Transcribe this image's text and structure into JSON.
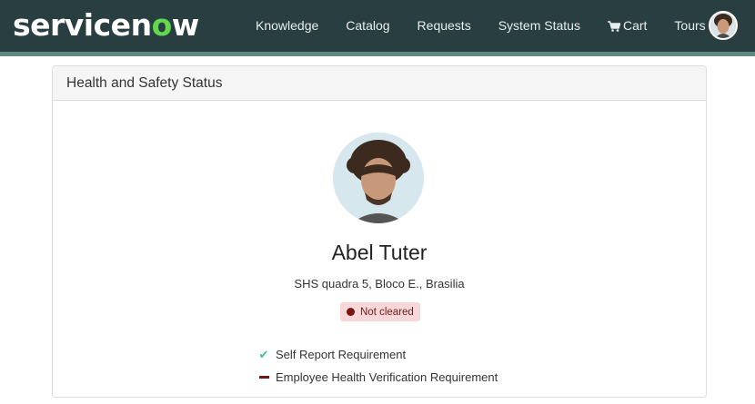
{
  "header": {
    "logo_text_a": "servicen",
    "logo_text_o": "o",
    "logo_text_b": "w",
    "nav": [
      "Knowledge",
      "Catalog",
      "Requests",
      "System Status",
      "Cart",
      "Tours"
    ]
  },
  "panel": {
    "title": "Health and Safety Status",
    "person": {
      "name": "Abel Tuter",
      "address": "SHS quadra 5, Bloco E., Brasilia",
      "status": "Not cleared"
    },
    "requirements": [
      {
        "label": "Self Report Requirement",
        "state": "complete",
        "icon": "check-icon"
      },
      {
        "label": "Employee Health Verification Requirement",
        "state": "incomplete",
        "icon": "dash-icon"
      }
    ]
  },
  "colors": {
    "header_bg": "#293e40",
    "accent": "#62d84e",
    "badge_bg": "#f8d7d9",
    "badge_text": "#6b1c1c",
    "check": "#3fbf8f"
  }
}
